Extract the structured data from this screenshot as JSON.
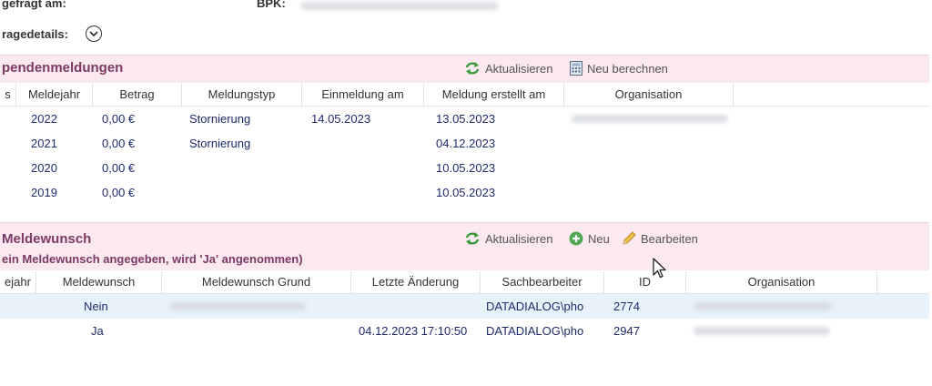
{
  "header": {
    "abgefragt_label": "gefragt am:",
    "bpk_label": "BPK:",
    "anfragedetails_label": "ragedetails:"
  },
  "icons": {
    "expand": "chevron-down-icon",
    "refresh": "refresh-icon",
    "calculator": "calculator-icon",
    "add": "plus-circle-icon",
    "edit": "pencil-icon",
    "cursor": "mouse-pointer-icon"
  },
  "colors": {
    "section_bg": "#fbe9ef",
    "section_title": "#7b3a64",
    "cell_text": "#1d2b6b",
    "selected_row": "#e8f2fb",
    "refresh_green": "#3e9a3e"
  },
  "spenden": {
    "title": "pendenmeldungen",
    "toolbar": {
      "refresh": "Aktualisieren",
      "recalc": "Neu berechnen"
    },
    "columns": [
      "s",
      "Meldejahr",
      "Betrag",
      "Meldungstyp",
      "Einmeldung am",
      "Meldung erstellt am",
      "Organisation"
    ],
    "rows": [
      {
        "jahr": "2022",
        "betrag": "0,00 €",
        "typ": "Stornierung",
        "einmeldung": "14.05.2023",
        "erstellt": "13.05.2023"
      },
      {
        "jahr": "2021",
        "betrag": "0,00 €",
        "typ": "Stornierung",
        "einmeldung": "",
        "erstellt": "04.12.2023"
      },
      {
        "jahr": "2020",
        "betrag": "0,00 €",
        "typ": "",
        "einmeldung": "",
        "erstellt": "10.05.2023"
      },
      {
        "jahr": "2019",
        "betrag": "0,00 €",
        "typ": "",
        "einmeldung": "",
        "erstellt": "10.05.2023"
      }
    ]
  },
  "meldewunsch": {
    "title": "Meldewunsch",
    "note": "ein Meldewunsch angegeben, wird 'Ja' angenommen)",
    "toolbar": {
      "refresh": "Aktualisieren",
      "new": "Neu",
      "edit": "Bearbeiten"
    },
    "columns": [
      "ejahr",
      "Meldewunsch",
      "Meldewunsch Grund",
      "Letzte Änderung",
      "Sachbearbeiter",
      "ID",
      "Organisation"
    ],
    "rows": [
      {
        "wunsch": "Nein",
        "aenderung": "",
        "sachbearbeiter": "DATADIALOG\\pho",
        "id": "2774"
      },
      {
        "wunsch": "Ja",
        "aenderung": "04.12.2023 17:10:50",
        "sachbearbeiter": "DATADIALOG\\pho",
        "id": "2947"
      }
    ]
  }
}
